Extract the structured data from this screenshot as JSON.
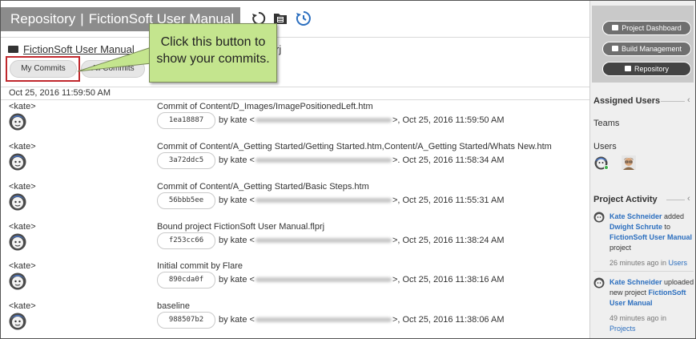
{
  "header": {
    "title_left": "Repository",
    "title_separator": "|",
    "title_right": "FictionSoft User Manual"
  },
  "project": {
    "name": "FictionSoft User Manual",
    "tail": "rj"
  },
  "filters": {
    "my_commits": "My Commits",
    "all_commits": "All Commits"
  },
  "callout": {
    "text": "Click this button to show your commits."
  },
  "date_header": "Oct 25, 2016 11:59:50 AM",
  "commits": [
    {
      "user": "<kate>",
      "message": "Commit of Content/D_Images/ImagePositionedLeft.htm",
      "hash": "1ea18887",
      "by": "by kate <",
      "close": ">",
      "time": ", Oct 25, 2016 11:59:50 AM"
    },
    {
      "user": "<kate>",
      "message": "Commit of Content/A_Getting Started/Getting Started.htm,Content/A_Getting Started/Whats New.htm",
      "hash": "3a72ddc5",
      "by": "by kate <",
      "close": ">",
      "time": ". Oct 25, 2016 11:58:34 AM"
    },
    {
      "user": "<kate>",
      "message": "Commit of Content/A_Getting Started/Basic Steps.htm",
      "hash": "56bbb5ee",
      "by": "by kate <",
      "close": ">",
      "time": ", Oct 25, 2016 11:55:31 AM"
    },
    {
      "user": "<kate>",
      "message": "Bound project FictionSoft User Manual.flprj",
      "hash": "f253cc66",
      "by": "by kate <",
      "close": ">",
      "time": ", Oct 25, 2016 11:38:24 AM"
    },
    {
      "user": "<kate>",
      "message": "Initial commit by Flare",
      "hash": "890cda0f",
      "by": "by kate <",
      "close": ">",
      "time": ", Oct 25, 2016 11:38:16 AM"
    },
    {
      "user": "<kate>",
      "message": "baseline",
      "hash": "988507b2",
      "by": "by kate <",
      "close": ">",
      "time": ", Oct 25, 2016 11:38:06 AM"
    }
  ],
  "sidebar": {
    "nav": {
      "dashboard": "Project Dashboard",
      "build": "Build Management",
      "repository": "Repository"
    },
    "assigned_users_title": "Assigned Users",
    "teams_label": "Teams",
    "users_label": "Users",
    "project_activity_title": "Project Activity",
    "activities": [
      {
        "actor": "Kate Schneider",
        "verb": " added ",
        "target": "Dwight Schrute",
        "prep": " to ",
        "object": "FictionSoft User Manual",
        "suffix": " project",
        "time": "26 minutes ago in ",
        "category": "Users"
      },
      {
        "actor": "Kate Schneider",
        "verb": " uploaded new project ",
        "object": "FictionSoft User Manual",
        "time": "49 minutes ago in ",
        "category": "Projects"
      }
    ]
  },
  "colors": {
    "title_bg": "#8c8c8c",
    "callout_bg": "#c4e58e",
    "highlight_border": "#c0282d",
    "link": "#2c6fbf",
    "nav_active": "#444444"
  }
}
